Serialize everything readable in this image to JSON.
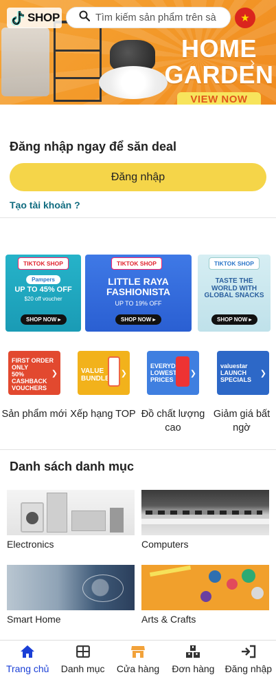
{
  "header": {
    "logo_text": "SHOP",
    "search_placeholder": "Tìm kiếm sản phẩm trên sà"
  },
  "hero_banner": {
    "title_line1": "HOME",
    "title_line2": "GARDEN",
    "cta": "VIEW NOW"
  },
  "login": {
    "title": "Đăng nhập ngay để săn deal",
    "button": "Đăng nhập",
    "create_account": "Tạo tài khoản ?"
  },
  "promos": [
    {
      "badge": "TIKTOK SHOP",
      "brand": "Pampers",
      "head": "UP TO 45% OFF",
      "sub": "$20 off voucher",
      "cta": "SHOP NOW"
    },
    {
      "badge": "TIKTOK SHOP",
      "head": "LITTLE RAYA FASHIONISTA",
      "sub": "UP TO 19% OFF",
      "cta": "SHOP NOW"
    },
    {
      "badge": "TIKTOK SHOP",
      "head": "TASTE THE WORLD WITH GLOBAL SNACKS",
      "cta": "SHOP NOW"
    }
  ],
  "quick_tiles": [
    {
      "tile_text": "FIRST ORDER ONLY\n50% CASHBACK VOUCHERS",
      "label": "Sản phẩm mới",
      "color": "#e2492f"
    },
    {
      "tile_text": "VALUE BUNDLES",
      "label": "Xếp hạng TOP",
      "color": "#f2b21b"
    },
    {
      "tile_text": "EVERYDAY LOWEST PRICES",
      "label": "Đồ chất lượng cao",
      "color": "#3f7fe0"
    },
    {
      "tile_text": "valuestar LAUNCH SPECIALS",
      "label": "Giảm giá bất ngờ",
      "color": "#2d68c7"
    }
  ],
  "categories": {
    "title": "Danh sách danh mục",
    "items": [
      {
        "label": "Electronics"
      },
      {
        "label": "Computers"
      },
      {
        "label": "Smart Home"
      },
      {
        "label": "Arts & Crafts"
      }
    ]
  },
  "bottom_nav": [
    {
      "label": "Trang chủ",
      "icon": "home-icon"
    },
    {
      "label": "Danh mục",
      "icon": "grid-icon"
    },
    {
      "label": "Cửa hàng",
      "icon": "store-icon"
    },
    {
      "label": "Đơn hàng",
      "icon": "boxes-icon"
    },
    {
      "label": "Đăng nhập",
      "icon": "login-icon"
    }
  ],
  "colors": {
    "accent_yellow": "#f5d549",
    "link_teal": "#0f6b7f",
    "nav_active": "#1a3fd6",
    "hero_orange": "#f39a2a"
  }
}
